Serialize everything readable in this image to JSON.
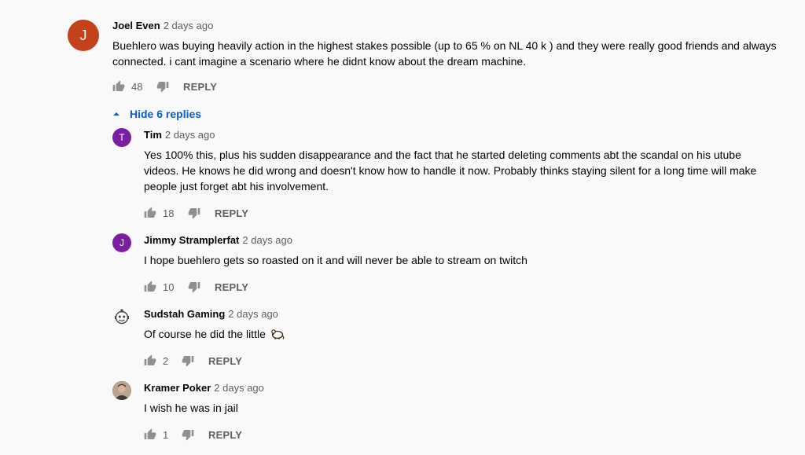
{
  "comment": {
    "author": "Joel Even",
    "time": "2 days ago",
    "avatar_letter": "J",
    "avatar_color": "#c4421b",
    "text": "Buehlero was buying heavily action in the highest stakes possible (up to 65 % on NL 40 k ) and they were really good friends and always connected. i cant imagine a scenario where he didnt know about the dream machine.",
    "likes": "48",
    "reply_label": "REPLY"
  },
  "hide_replies_label": "Hide 6 replies",
  "replies": [
    {
      "author": "Tim",
      "time": "2 days ago",
      "avatar_letter": "T",
      "avatar_color": "#7b1fa2",
      "text": "Yes 100% this, plus his sudden disappearance and the fact that he started deleting comments abt the scandal on his utube videos. He knows he did wrong and doesn't know how to handle it now. Probably thinks staying silent for a long time will make people just forget abt his involvement.",
      "likes": "18",
      "reply_label": "REPLY"
    },
    {
      "author": "Jimmy Stramplerfat",
      "time": "2 days ago",
      "avatar_letter": "J",
      "avatar_color": "#7b1fa2",
      "text": "I hope buehlero gets so roasted on it and will never be able to stream on twitch",
      "likes": "10",
      "reply_label": "REPLY"
    },
    {
      "author": "Sudstah Gaming",
      "time": "2 days ago",
      "avatar_icon": "robot-avatar-icon",
      "text": "Of course he did the little",
      "emoji_icon": "rat-emoji-icon",
      "likes": "2",
      "reply_label": "REPLY"
    },
    {
      "author": "Kramer Poker",
      "time": "2 days ago",
      "avatar_icon": "photo-avatar",
      "text": "I wish he was in jail",
      "likes": "1",
      "reply_label": "REPLY"
    }
  ],
  "colors": {
    "link_blue": "#065fd4",
    "secondary_text": "#606060",
    "background": "#f9f9f9"
  }
}
